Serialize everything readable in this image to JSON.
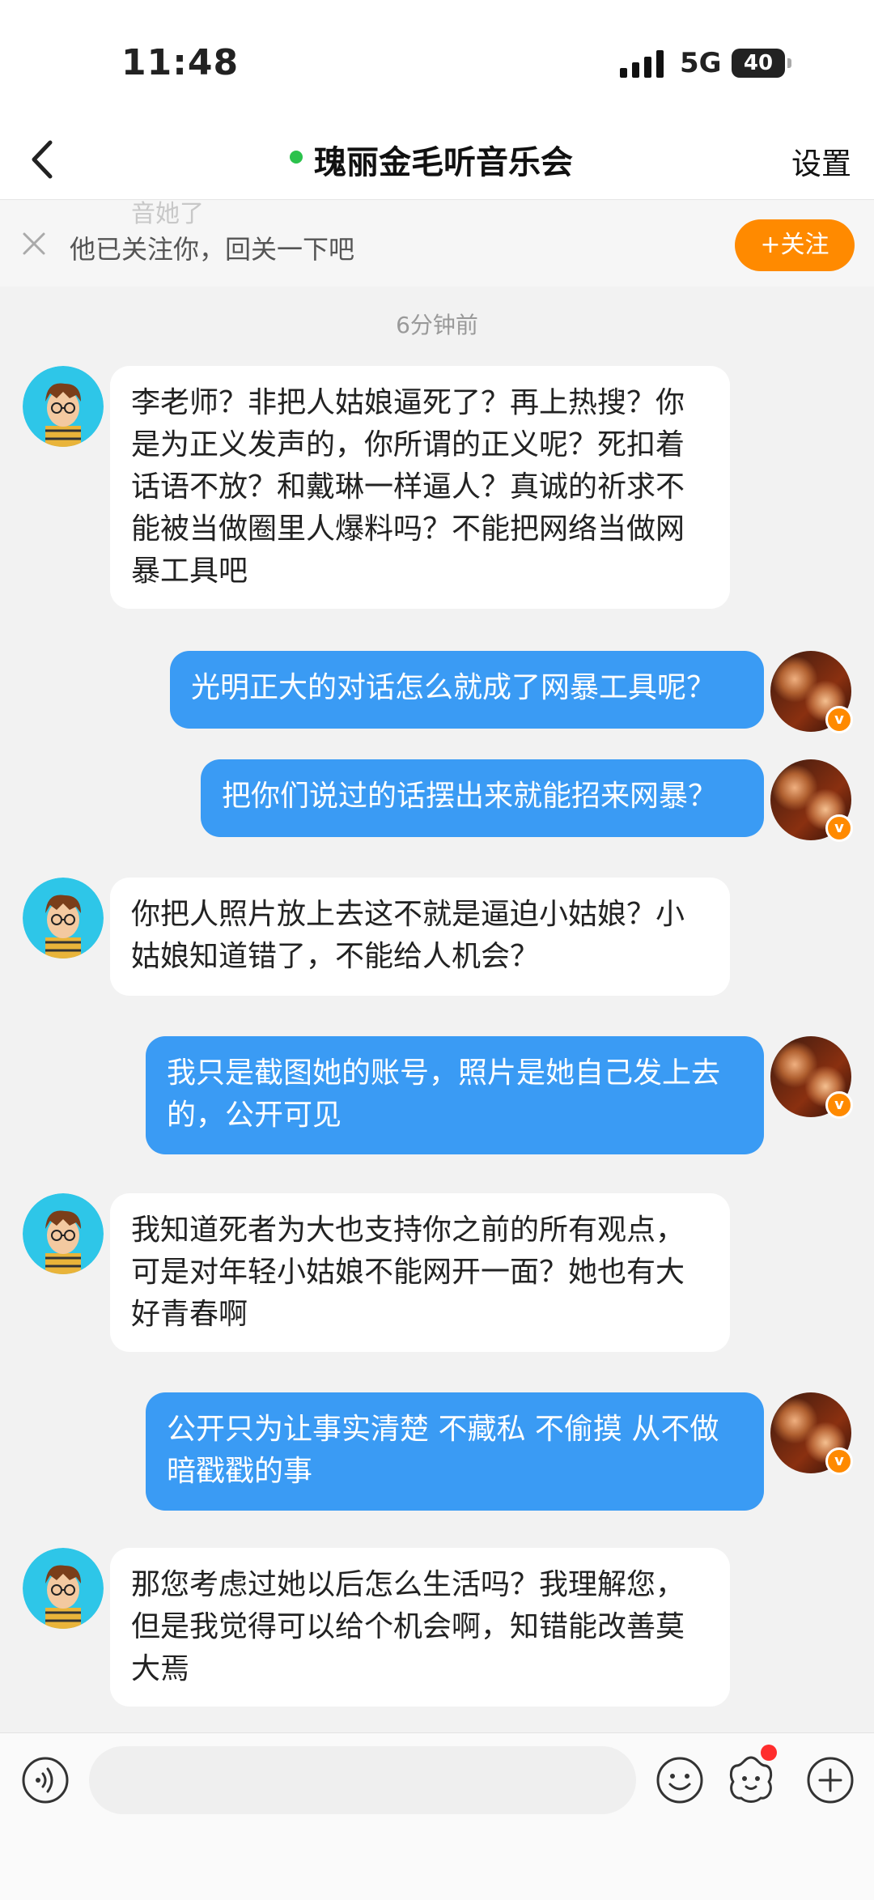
{
  "status_bar": {
    "time": "11:48",
    "network": "5G",
    "battery": "40"
  },
  "nav": {
    "title": "瑰丽金毛听音乐会",
    "settings_label": "设置"
  },
  "follow_banner": {
    "text": "他已关注你，回关一下吧",
    "button_label": "+关注",
    "partial_text": "音她了"
  },
  "timestamp": "6分钟前",
  "messages": [
    {
      "side": "in",
      "text": "李老师？非把人姑娘逼死了？再上热搜？你是为正义发声的，你所谓的正义呢？死扣着话语不放？和戴琳一样逼人？真诚的祈求不能被当做圈里人爆料吗？不能把网络当做网暴工具吧"
    },
    {
      "side": "out",
      "text": "光明正大的对话怎么就成了网暴工具呢？"
    },
    {
      "side": "out",
      "text": "把你们说过的话摆出来就能招来网暴？"
    },
    {
      "side": "in",
      "text": "你把人照片放上去这不就是逼迫小姑娘？小姑娘知道错了，不能给人机会？"
    },
    {
      "side": "out",
      "text": "我只是截图她的账号，照片是她自己发上去的，公开可见"
    },
    {
      "side": "in",
      "text": "我知道死者为大也支持你之前的所有观点，可是对年轻小姑娘不能网开一面？她也有大好青春啊"
    },
    {
      "side": "out",
      "text": "公开只为让事实清楚 不藏私 不偷摸 从不做暗戳戳的事"
    },
    {
      "side": "in",
      "text": "那您考虑过她以后怎么生活吗？我理解您，但是我觉得可以给个机会啊，知错能改善莫大焉"
    }
  ],
  "colors": {
    "outgoing_bubble": "#3a9bf4",
    "incoming_bubble": "#ffffff",
    "accent": "#ff8a00",
    "online": "#2bc24c"
  },
  "icons": {
    "back": "chevron-left-icon",
    "close": "close-icon",
    "voice": "voice-icon",
    "emoji": "emoji-icon",
    "sticker": "sticker-icon",
    "plus": "plus-icon"
  }
}
